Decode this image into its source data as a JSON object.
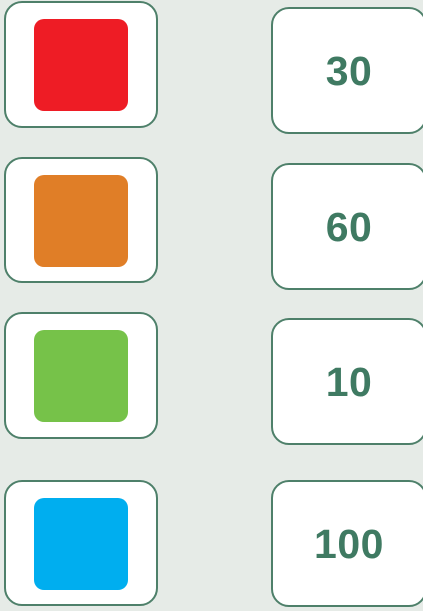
{
  "rows": [
    {
      "swatch_color": "#ee1c25",
      "swatch_name": "red",
      "value": "30"
    },
    {
      "swatch_color": "#e07e27",
      "swatch_name": "orange",
      "value": "60"
    },
    {
      "swatch_color": "#76c249",
      "swatch_name": "green",
      "value": "10"
    },
    {
      "swatch_color": "#00aeef",
      "swatch_name": "blue",
      "value": "100"
    }
  ],
  "colors": {
    "background": "#e6ebe7",
    "tile_border": "#4e806a",
    "number_text": "#3f7a62"
  }
}
